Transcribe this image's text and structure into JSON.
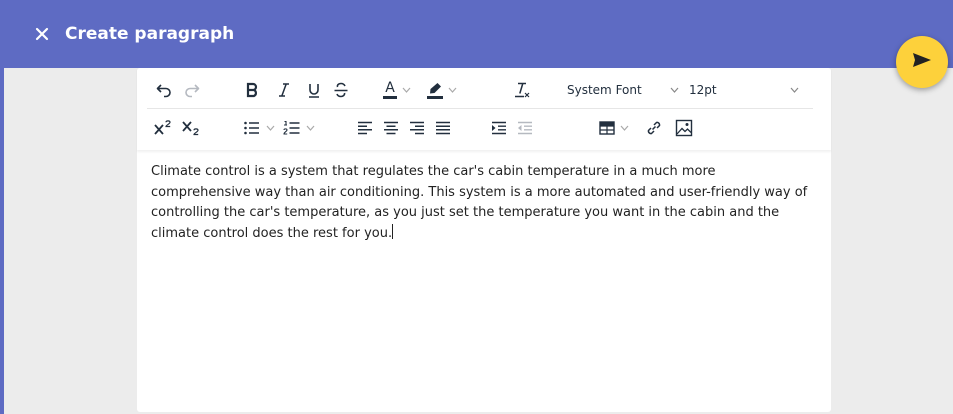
{
  "header": {
    "title": "Create paragraph",
    "close_icon": "close-icon",
    "background_color": "#5e6bc3"
  },
  "fab": {
    "icon": "send-icon",
    "color": "#fdd13b"
  },
  "toolbar": {
    "text_color": "A",
    "font_family": {
      "selected": "System Font"
    },
    "font_size": {
      "selected": "12pt"
    },
    "icons": [
      "undo-icon",
      "redo-icon",
      "bold-icon",
      "italic-icon",
      "underline-icon",
      "strikethrough-icon",
      "text-color-icon",
      "highlight-icon",
      "clear-formatting-icon",
      "superscript-icon",
      "subscript-icon",
      "bullet-list-icon",
      "numbered-list-icon",
      "align-left-icon",
      "align-center-icon",
      "align-right-icon",
      "justify-icon",
      "indent-icon",
      "outdent-icon",
      "table-icon",
      "link-icon",
      "image-icon"
    ]
  },
  "editor": {
    "content": "Climate control is a system that regulates the car's cabin temperature in a much more comprehensive way than air conditioning. This system is a more automated and user-friendly way of controlling the car's temperature, as you just set the temperature you want in the cabin and the climate control does the rest for you."
  }
}
